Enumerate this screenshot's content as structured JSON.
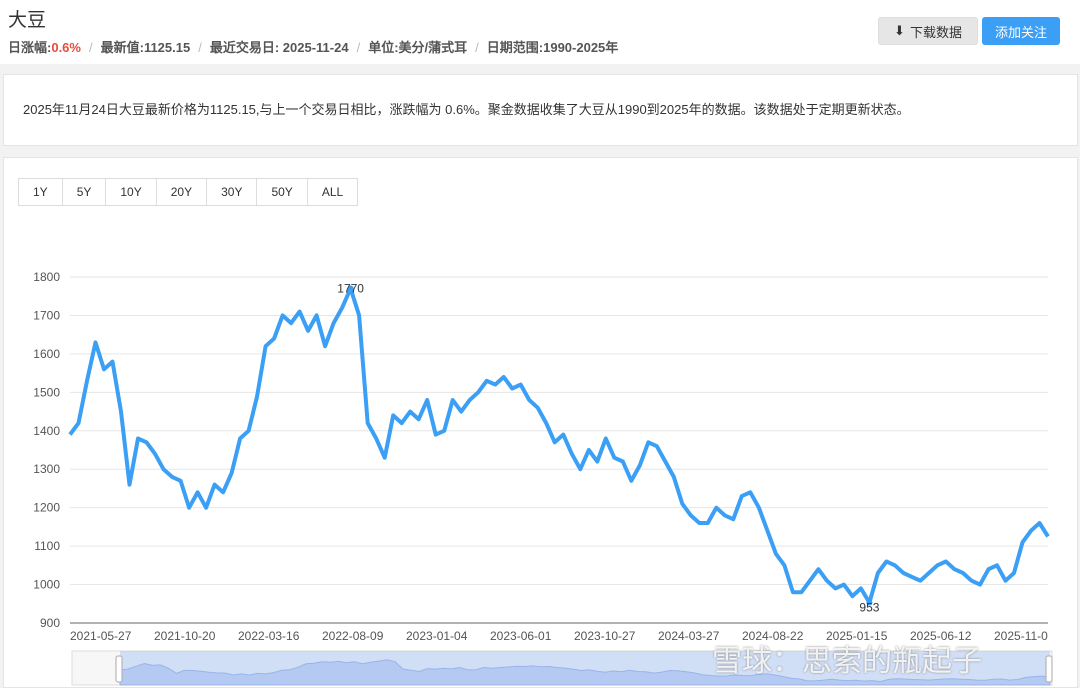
{
  "header": {
    "title": "大豆",
    "change_label": "日涨幅:",
    "change_value": "0.6%",
    "latest": "最新值:1125.15",
    "last_date": "最近交易日: 2025-11-24",
    "unit": "单位:美分/蒲式耳",
    "range": "日期范围:1990-2025年",
    "separator": "/",
    "download_label": "下载数据",
    "follow_label": "添加关注"
  },
  "description": "2025年11月24日大豆最新价格为1125.15,与上一个交易日相比，涨跌幅为 0.6%。聚金数据收集了大豆从1990到2025年的数据。该数据处于定期更新状态。",
  "range_buttons": [
    "1Y",
    "5Y",
    "10Y",
    "20Y",
    "30Y",
    "50Y",
    "ALL"
  ],
  "watermark": "雪球：思索的瓶起子",
  "chart_data": {
    "type": "line",
    "title": "",
    "xlabel": "",
    "ylabel": "",
    "ylim": [
      900,
      1800
    ],
    "yticks": [
      900,
      1000,
      1100,
      1200,
      1300,
      1400,
      1500,
      1600,
      1700,
      1800
    ],
    "xtick_labels": [
      "2021-05-27",
      "2021-10-20",
      "2022-03-16",
      "2022-08-09",
      "2023-01-04",
      "2023-06-01",
      "2023-10-27",
      "2024-03-27",
      "2024-08-22",
      "2025-01-15",
      "2025-06-12",
      "2025-11-0"
    ],
    "color": "#3a9ff5",
    "annotations": [
      {
        "label": "1770",
        "value": 1770,
        "type": "max"
      },
      {
        "label": "953",
        "value": 953,
        "type": "min"
      }
    ],
    "series": [
      {
        "name": "大豆",
        "values": [
          1390,
          1420,
          1530,
          1630,
          1560,
          1580,
          1450,
          1260,
          1380,
          1370,
          1340,
          1300,
          1280,
          1270,
          1200,
          1240,
          1200,
          1260,
          1240,
          1290,
          1380,
          1400,
          1490,
          1620,
          1640,
          1700,
          1680,
          1710,
          1660,
          1700,
          1620,
          1680,
          1720,
          1770,
          1700,
          1420,
          1380,
          1330,
          1440,
          1420,
          1450,
          1430,
          1480,
          1390,
          1400,
          1480,
          1450,
          1480,
          1500,
          1530,
          1520,
          1540,
          1510,
          1520,
          1480,
          1460,
          1420,
          1370,
          1390,
          1340,
          1300,
          1350,
          1320,
          1380,
          1330,
          1320,
          1270,
          1310,
          1370,
          1360,
          1320,
          1280,
          1210,
          1180,
          1160,
          1160,
          1200,
          1180,
          1170,
          1230,
          1240,
          1200,
          1140,
          1080,
          1050,
          980,
          980,
          1010,
          1040,
          1010,
          990,
          1000,
          970,
          990,
          953,
          1030,
          1060,
          1050,
          1030,
          1020,
          1010,
          1030,
          1050,
          1060,
          1040,
          1030,
          1010,
          1000,
          1040,
          1050,
          1010,
          1030,
          1110,
          1140,
          1160,
          1125
        ]
      }
    ]
  }
}
